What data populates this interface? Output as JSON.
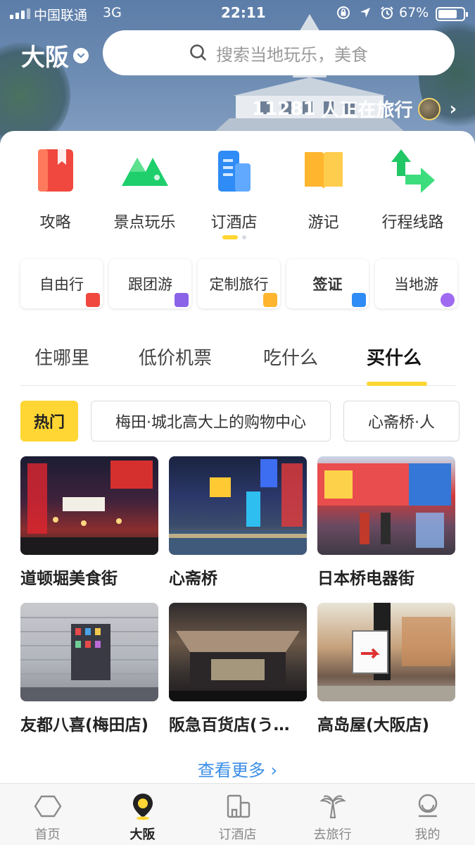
{
  "status_bar": {
    "carrier": "中国联通",
    "network": "3G",
    "time": "22:11",
    "battery": "67%"
  },
  "header": {
    "city": "大阪",
    "search_placeholder": "搜索当地玩乐，美食",
    "travelers_count": "11281",
    "travelers_text": "人正在旅行"
  },
  "quick_entries": [
    {
      "label": "攻略",
      "icon": "guide-book-icon",
      "color": "#f0483e"
    },
    {
      "label": "景点玩乐",
      "icon": "mountain-icon",
      "color": "#1fcf6b"
    },
    {
      "label": "订酒店",
      "icon": "hotel-building-icon",
      "color": "#2f8bf5"
    },
    {
      "label": "游记",
      "icon": "open-book-icon",
      "color": "#ffb52e"
    },
    {
      "label": "行程线路",
      "icon": "route-icon",
      "color": "#22c765"
    }
  ],
  "service_chips": [
    {
      "label": "自由行",
      "color": "#f0483e"
    },
    {
      "label": "跟团游",
      "color": "#8a63e8"
    },
    {
      "label": "定制旅行",
      "color": "#ffb52e"
    },
    {
      "label": "签证",
      "color": "#2f8bf5"
    },
    {
      "label": "当地游",
      "color": "#a06af0"
    }
  ],
  "tabs": [
    "住哪里",
    "低价机票",
    "吃什么",
    "买什么"
  ],
  "active_tab": "买什么",
  "filters": [
    "热门",
    "梅田·城北高大上的购物中心",
    "心斋桥·人"
  ],
  "pois": [
    {
      "name": "道顿堀美食街"
    },
    {
      "name": "心斋桥"
    },
    {
      "name": "日本桥电器街"
    },
    {
      "name": "友都八喜(梅田店)"
    },
    {
      "name": "阪急百货店(う…"
    },
    {
      "name": "高岛屋(大阪店)"
    }
  ],
  "more_link": "查看更多 ›",
  "bottom_nav": [
    {
      "label": "首页",
      "icon": "home-icon"
    },
    {
      "label": "大阪",
      "icon": "destination-pin-icon"
    },
    {
      "label": "订酒店",
      "icon": "hotel-icon"
    },
    {
      "label": "去旅行",
      "icon": "palm-tree-icon"
    },
    {
      "label": "我的",
      "icon": "profile-icon"
    }
  ],
  "active_nav": "大阪",
  "colors": {
    "accent": "#ffd633",
    "link": "#3a8ee6"
  }
}
